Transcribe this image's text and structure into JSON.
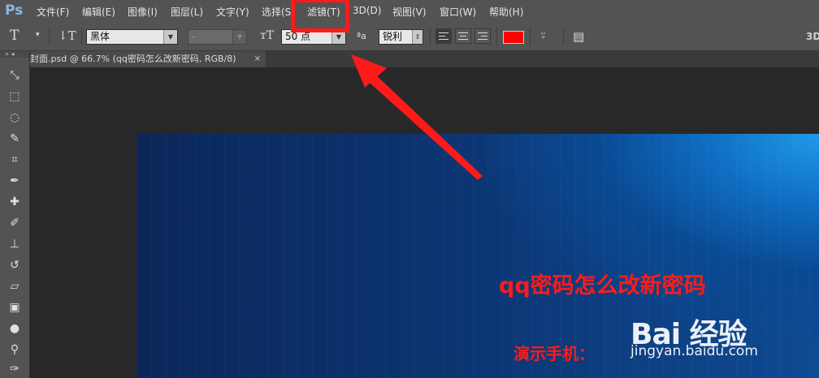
{
  "app": {
    "logo": "Ps"
  },
  "menu": [
    {
      "label": "文件(F)"
    },
    {
      "label": "编辑(E)"
    },
    {
      "label": "图像(I)"
    },
    {
      "label": "图层(L)"
    },
    {
      "label": "文字(Y)"
    },
    {
      "label": "选择(S)"
    },
    {
      "label": "滤镜(T)"
    },
    {
      "label": "3D(D)"
    },
    {
      "label": "视图(V)"
    },
    {
      "label": "窗口(W)"
    },
    {
      "label": "帮助(H)"
    }
  ],
  "options": {
    "font_family": "黑体",
    "font_style": "-",
    "font_size": "50 点",
    "antialias": "锐利",
    "text_color": "#ff0000",
    "right_label": "3D"
  },
  "tab": {
    "title": "封面.psd @ 66.7% (qq密码怎么改新密码, RGB/8)",
    "close": "×"
  },
  "canvas": {
    "title": "qq密码怎么改新密码",
    "subtitle": "演示手机：",
    "title_color": "#ff1b1b"
  },
  "watermark": {
    "logo": "Bai 经验",
    "url": "jingyan.baidu.com"
  },
  "annotation": {
    "color": "#ff1a1a"
  }
}
